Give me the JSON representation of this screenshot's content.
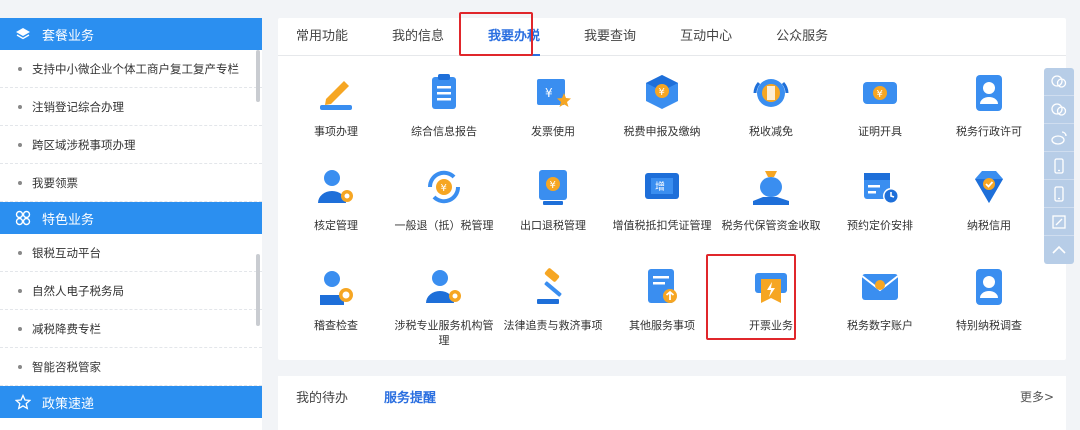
{
  "sidebar": {
    "sections": [
      {
        "title": "套餐业务",
        "icon": "layers-icon",
        "items": [
          "支持中小微企业个体工商户复工复产专栏",
          "注销登记综合办理",
          "跨区域涉税事项办理",
          "我要领票"
        ]
      },
      {
        "title": "特色业务",
        "icon": "grid-icon",
        "items": [
          "银税互动平台",
          "自然人电子税务局",
          "减税降费专栏",
          "智能咨税管家"
        ]
      },
      {
        "title": "政策速递",
        "icon": "star-icon",
        "items": []
      }
    ]
  },
  "tabs": [
    "常用功能",
    "我的信息",
    "我要办税",
    "我要查询",
    "互动中心",
    "公众服务"
  ],
  "active_tab": "我要办税",
  "services": [
    {
      "label": "事项办理",
      "icon": "pen-edit-icon"
    },
    {
      "label": "综合信息报告",
      "icon": "clipboard-report-icon"
    },
    {
      "label": "发票使用",
      "icon": "invoice-star-icon"
    },
    {
      "label": "税费申报及缴纳",
      "icon": "box-yuan-icon"
    },
    {
      "label": "税收减免",
      "icon": "tax-relief-icon"
    },
    {
      "label": "证明开具",
      "icon": "certificate-ticket-icon"
    },
    {
      "label": "税务行政许可",
      "icon": "badge-person-icon"
    },
    {
      "label": "核定管理",
      "icon": "person-gear-icon"
    },
    {
      "label": "一般退（抵）税管理",
      "icon": "yuan-refresh-icon"
    },
    {
      "label": "出口退税管理",
      "icon": "export-yuan-icon"
    },
    {
      "label": "增值税抵扣凭证管理",
      "icon": "vat-ticket-icon"
    },
    {
      "label": "税务代保管资金收取",
      "icon": "money-bag-hand-icon"
    },
    {
      "label": "预约定价安排",
      "icon": "calendar-clock-icon"
    },
    {
      "label": "纳税信用",
      "icon": "diamond-check-icon"
    },
    {
      "label": "稽查检查",
      "icon": "person-search-icon"
    },
    {
      "label": "涉税专业服务机构管理",
      "icon": "person-gear-icon"
    },
    {
      "label": "法律追责与救济事项",
      "icon": "gavel-icon"
    },
    {
      "label": "其他服务事项",
      "icon": "document-up-icon"
    },
    {
      "label": "开票业务",
      "icon": "invoice-bolt-icon"
    },
    {
      "label": "税务数字账户",
      "icon": "envelope-person-icon"
    },
    {
      "label": "特别纳税调查",
      "icon": "badge-person-icon"
    }
  ],
  "highlighted_service": "开票业务",
  "float_bar": [
    "chat-icon",
    "chat-icon",
    "weibo-icon",
    "mobile-icon",
    "mobile-icon",
    "edit-icon",
    "up-arrow-icon"
  ],
  "bottom": {
    "tabs": [
      "我的待办",
      "服务提醒"
    ],
    "active": "服务提醒",
    "more": "更多>"
  },
  "colors": {
    "primary": "#2b8ff0",
    "accent": "#2b6fe0",
    "highlight": "#e0262b"
  }
}
